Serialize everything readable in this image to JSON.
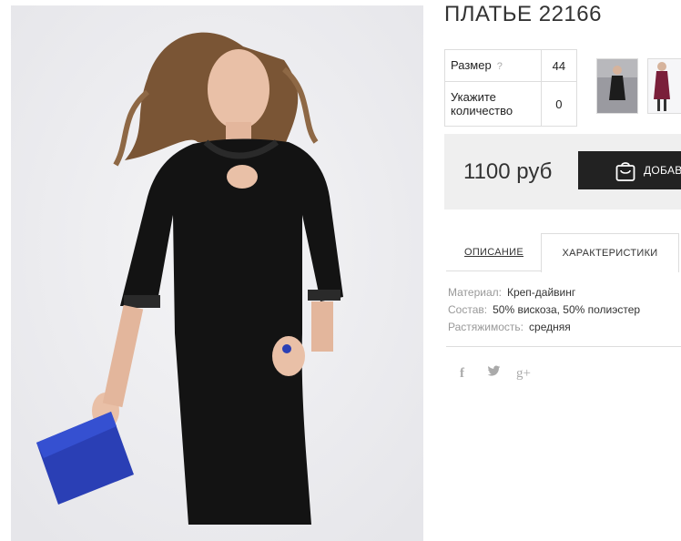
{
  "product": {
    "title": "ПЛАТЬЕ 22166",
    "price": "1100 руб",
    "add_to_cart_label": "ДОБАВИТЬ"
  },
  "options": [
    {
      "label": "Размер",
      "help": "?",
      "value": "44"
    },
    {
      "label": "Укажите количество",
      "help": "",
      "value": "0"
    }
  ],
  "tabs": [
    {
      "label": "ОПИСАНИЕ",
      "active": false
    },
    {
      "label": "ХАРАКТЕРИСТИКИ",
      "active": true
    }
  ],
  "characteristics": [
    {
      "key": "Материал:",
      "value": "Креп-дайвинг"
    },
    {
      "key": "Состав:",
      "value": "50% вискоза, 50% полиэстер"
    },
    {
      "key": "Растяжимость:",
      "value": "средняя"
    }
  ],
  "social": [
    "facebook-icon",
    "twitter-icon",
    "google-plus-icon"
  ],
  "colors": {
    "button_bg": "#222222",
    "price_box_bg": "#efefef",
    "dress": "#131313",
    "clutch": "#2a3fb5"
  },
  "icons": {
    "fb": "f",
    "gplus": "g+"
  }
}
